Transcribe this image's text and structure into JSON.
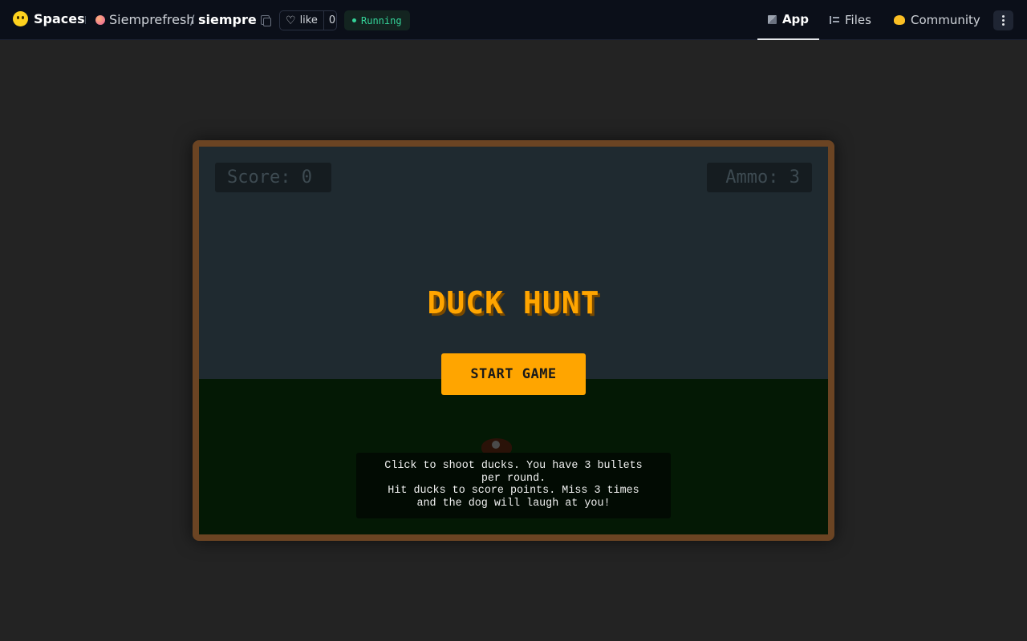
{
  "header": {
    "brand": "Spaces",
    "owner": "Siemprefresh",
    "separator": "/",
    "repo": "siempre",
    "like_label": "like",
    "like_count": "0",
    "status": "Running",
    "nav": {
      "app": "App",
      "files": "Files",
      "community": "Community"
    }
  },
  "game": {
    "score_text": "Score: 0",
    "ammo_text": "Ammo: 3",
    "title": "DUCK HUNT",
    "start_button": "START GAME",
    "instructions_line1": "Click to shoot ducks. You have 3 bullets per round.",
    "instructions_line2": "Hit ducks to score points. Miss 3 times and the dog will laugh at you!"
  },
  "colors": {
    "frame": "#6b4423",
    "sky": "#1f2a30",
    "grass": "#041905",
    "accent": "#ffa500",
    "status": "#34d399"
  }
}
